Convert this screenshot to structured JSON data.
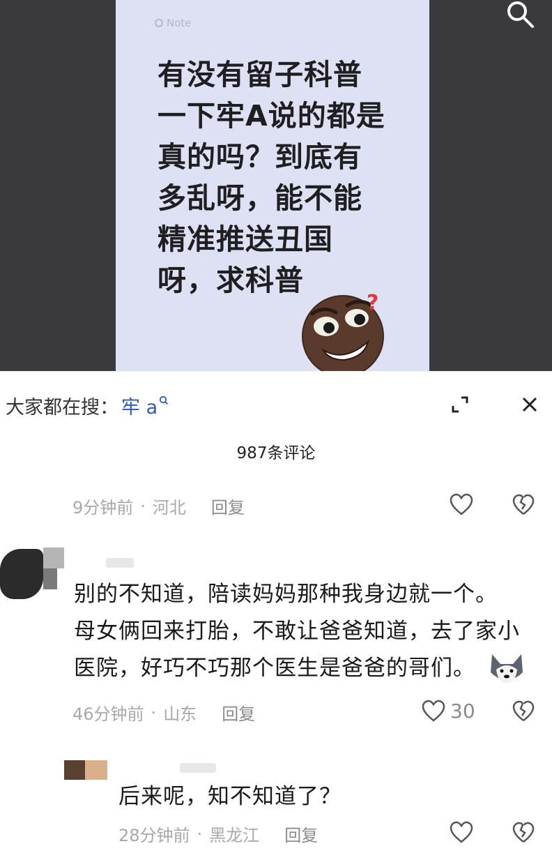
{
  "note": {
    "label": "Note",
    "text": "有没有留子科普\n一下牢A说的都是\n真的吗？到底有\n多乱呀，能不能\n精准推送丑国\n呀，求科普"
  },
  "hot_search": {
    "prefix": "大家都在搜：",
    "term": "牢 a"
  },
  "comments_header": {
    "count_text": "987条评论"
  },
  "comments": [
    {
      "time": "9分钟前",
      "location": "河北",
      "reply": "回复",
      "likes": ""
    },
    {
      "text": "别的不知道，陪读妈妈那种我身边就一个。\n母女俩回来打胎，不敢让爸爸知道，去了家小\n医院，好巧不巧那个医生是爸爸的哥们。",
      "time": "46分钟前",
      "location": "山东",
      "reply": "回复",
      "likes": "30"
    },
    {
      "text": "后来呢，知不知道了？",
      "time": "28分钟前",
      "location": "黑龙江",
      "reply": "回复",
      "likes": ""
    }
  ],
  "colors": {
    "card_bg": "#dde1f3",
    "dark_bg": "#3a3a3c",
    "link_blue": "#2d58b8"
  },
  "icons": [
    "search-icon",
    "expand-icon",
    "close-icon",
    "heart-icon",
    "broken-heart-icon",
    "husky-emoji-icon",
    "confused-face-emoji"
  ]
}
